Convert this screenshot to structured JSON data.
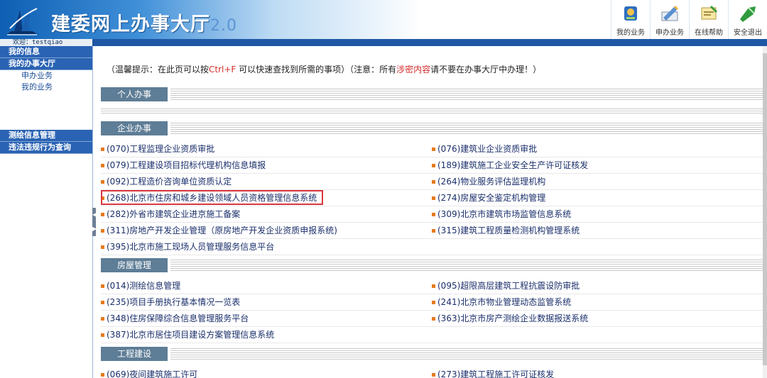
{
  "header": {
    "title": "建委网上办事大厅",
    "version": "2.0",
    "nav": [
      {
        "label": "我的业务",
        "icon": "my-business-icon"
      },
      {
        "label": "申办业务",
        "icon": "apply-business-icon"
      },
      {
        "label": "在线帮助",
        "icon": "online-help-icon"
      },
      {
        "label": "安全退出",
        "icon": "logout-icon"
      }
    ],
    "welcome": "欢迎：testqiao"
  },
  "sidebar": {
    "items": [
      {
        "label": "我的信息",
        "type": "head"
      },
      {
        "label": "我的办事大厅",
        "type": "head"
      },
      {
        "label": "申办业务",
        "type": "sub"
      },
      {
        "label": "我的业务",
        "type": "sub"
      },
      {
        "label": "测绘信息管理",
        "type": "head"
      },
      {
        "label": "违法违规行为查询",
        "type": "head"
      }
    ]
  },
  "main": {
    "hint": {
      "part1": "（温馨提示：在此页可以按",
      "key": "Ctrl+F",
      "part2": " 可以快速查找到所需的事项）（注意：所有",
      "warn": "涉密内容",
      "part3": "请不要在办事大厅中办理！）"
    },
    "sections": {
      "personal": "个人办事",
      "enterprise": "企业办事",
      "housing": "房屋管理",
      "construction": "工程建设"
    },
    "enterprise_items": [
      [
        "(070)工程监理企业资质审批",
        "(076)建筑业企业资质审批"
      ],
      [
        "(079)工程建设项目招标代理机构信息填报",
        "(189)建筑施工企业安全生产许可证核发"
      ],
      [
        "(092)工程造价咨询单位资质认定",
        "(264)物业服务评估监理机构"
      ],
      [
        "(268)北京市住房和城乡建设领域人员资格管理信息系统",
        "(274)房屋安全鉴定机构管理"
      ],
      [
        "(282)外省市建筑企业进京施工备案",
        "(309)北京市建筑市场监管信息系统"
      ],
      [
        "(311)房地产开发企业管理（原房地产开发企业资质申报系统)",
        "(315)建筑工程质量检测机构管理系统"
      ],
      [
        "(395)北京市施工现场人员管理服务信息平台",
        ""
      ]
    ],
    "housing_items": [
      [
        "(014)测绘信息管理",
        "(095)超限高层建筑工程抗震设防审批"
      ],
      [
        "(235)项目手册执行基本情况一览表",
        "(241)北京市物业管理动态监管系统"
      ],
      [
        "(348)住房保障综合信息管理服务平台",
        "(363)北京市房产测绘企业数据报送系统"
      ],
      [
        "(387)北京市居住项目建设方案管理信息系统",
        ""
      ]
    ],
    "construction_items": [
      [
        "(069)夜间建筑施工许可",
        "(273)建筑工程施工许可证核发"
      ]
    ]
  }
}
